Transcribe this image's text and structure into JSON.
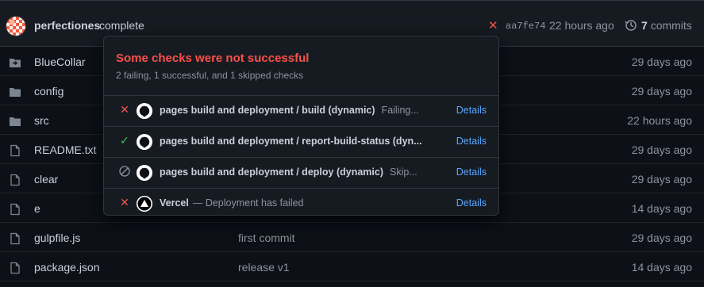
{
  "commit": {
    "author": "perfectiones",
    "message": "complete",
    "sha": "aa7fe74",
    "time": "22 hours ago",
    "commit_count": "7",
    "commits_label": "commits"
  },
  "files": [
    {
      "name": "BlueCollar",
      "type": "submodule",
      "message": "",
      "date": "29 days ago"
    },
    {
      "name": "config",
      "type": "folder",
      "message": "",
      "date": "29 days ago"
    },
    {
      "name": "src",
      "type": "folder",
      "message": "",
      "date": "22 hours ago"
    },
    {
      "name": "README.txt",
      "type": "file",
      "message": "",
      "date": "29 days ago"
    },
    {
      "name": "clear",
      "type": "file",
      "message": "",
      "date": "29 days ago"
    },
    {
      "name": "e",
      "type": "file",
      "message": "",
      "date": "14 days ago"
    },
    {
      "name": "gulpfile.js",
      "type": "file",
      "message": "first commit",
      "date": "29 days ago"
    },
    {
      "name": "package.json",
      "type": "file",
      "message": "release v1",
      "date": "14 days ago"
    }
  ],
  "popover": {
    "title": "Some checks were not successful",
    "subtitle": "2 failing, 1 successful, and 1 skipped checks",
    "checks": [
      {
        "status": "failed",
        "logo": "github-icon",
        "name": "pages build and deployment / build (dynamic)",
        "desc": "Failing...",
        "details": "Details"
      },
      {
        "status": "success",
        "logo": "github-icon",
        "name": "pages build and deployment / report-build-status (dyn...",
        "desc": "",
        "details": "Details"
      },
      {
        "status": "skipped",
        "logo": "github-icon",
        "name": "pages build and deployment / deploy (dynamic)",
        "desc": "Skip...",
        "details": "Details"
      },
      {
        "status": "failed",
        "logo": "vercel-icon",
        "name": "Vercel",
        "desc": "— Deployment has failed",
        "details": "Details"
      }
    ]
  },
  "colors": {
    "fail": "#f85149",
    "success": "#3fb950",
    "skipped": "#8b949e",
    "link": "#58a6ff"
  }
}
